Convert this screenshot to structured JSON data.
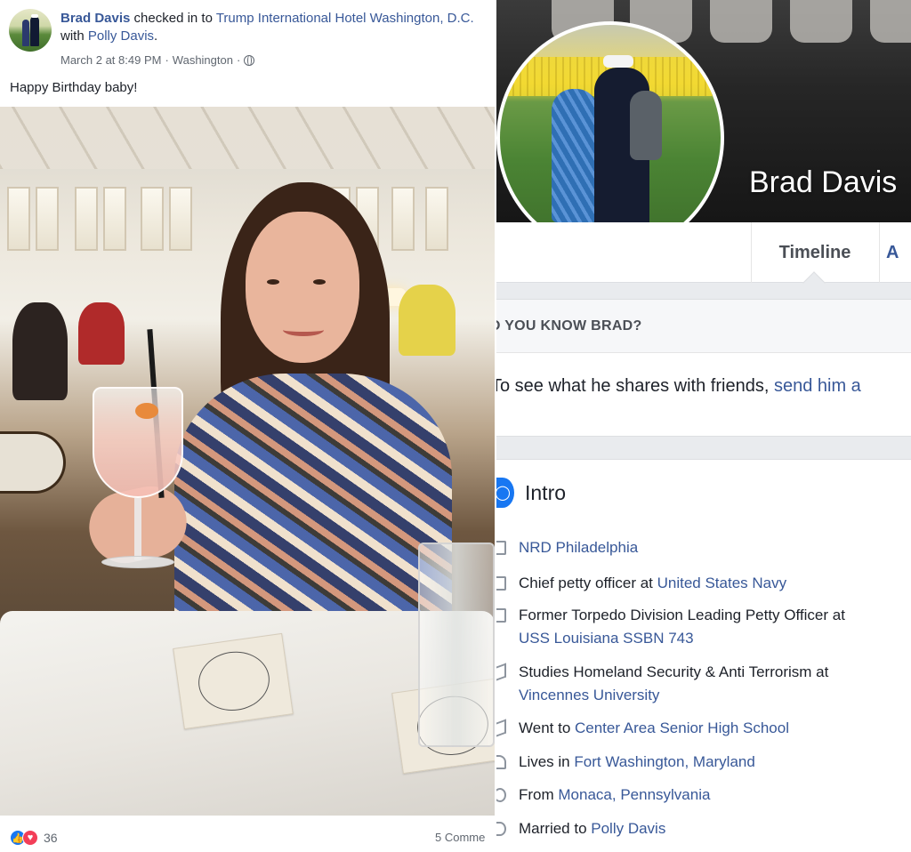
{
  "post": {
    "author": "Brad Davis",
    "action": " checked in to ",
    "place": "Trump International Hotel Washington, D.C.",
    "with_text": " with ",
    "tagged": "Polly Davis",
    "period": ".",
    "timestamp": "March 2 at 8:49 PM",
    "separator": " · ",
    "location": "Washington",
    "separator2": " · ",
    "message": "Happy Birthday baby!",
    "reaction_count": "36",
    "comments_label": "5 Comme",
    "reaction_icons": [
      "like-icon",
      "love-icon"
    ]
  },
  "profile": {
    "name": "Brad Davis",
    "tabs": [
      {
        "label": "Timeline"
      },
      {
        "label": "A"
      }
    ],
    "know_heading": "O YOU KNOW BRAD?",
    "know_text": "To see what he shares with friends, ",
    "know_link": "send him a",
    "intro_title": "Intro",
    "intro_items": [
      {
        "icon": "briefcase-icon",
        "prefix": "",
        "link": "NRD Philadelphia",
        "suffix": ""
      },
      {
        "icon": "briefcase-icon",
        "prefix": "Chief petty officer at ",
        "link": "United States Navy",
        "suffix": ""
      },
      {
        "icon": "briefcase-icon",
        "prefix": "Former Torpedo Division Leading Petty Officer at ",
        "link": "USS Louisiana SSBN 743",
        "suffix": ""
      },
      {
        "icon": "graduation-cap-icon",
        "prefix": "Studies Homeland Security & Anti Terrorism at ",
        "link": "Vincennes University",
        "suffix": ""
      },
      {
        "icon": "graduation-cap-icon",
        "prefix": "Went to ",
        "link": "Center Area Senior High School",
        "suffix": ""
      },
      {
        "icon": "house-icon",
        "prefix": "Lives in ",
        "link": "Fort Washington, Maryland",
        "suffix": ""
      },
      {
        "icon": "location-pin-icon",
        "prefix": "From ",
        "link": "Monaca, Pennsylvania",
        "suffix": ""
      },
      {
        "icon": "heart-icon",
        "prefix": "Married to ",
        "link": "Polly Davis",
        "suffix": ""
      }
    ]
  },
  "colors": {
    "link": "#385898",
    "text": "#1d2129",
    "muted": "#606770",
    "like": "#1877f2",
    "love": "#f33e58",
    "page_bg": "#e9ebee"
  }
}
